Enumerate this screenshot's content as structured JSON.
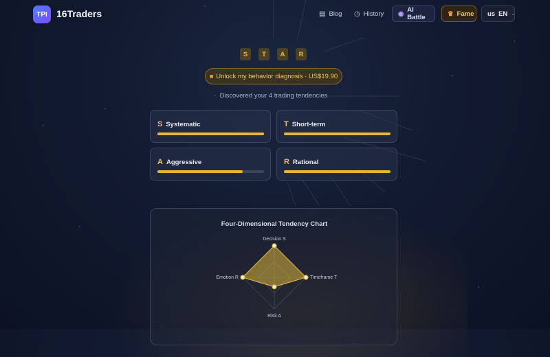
{
  "header": {
    "logo_text": "TPI",
    "brand": "16Traders",
    "nav": [
      {
        "label": "Blog",
        "icon": "blog-icon"
      },
      {
        "label": "History",
        "icon": "clock-icon"
      }
    ],
    "ai_battle": {
      "label": "AI Battle",
      "icon": "robot-icon"
    },
    "fame": {
      "label": "Fame",
      "icon": "crown-icon"
    },
    "language": {
      "prefix": "us",
      "value": "EN",
      "icon": "chevron-down-icon"
    }
  },
  "result": {
    "letters": [
      "S",
      "T",
      "A",
      "R"
    ],
    "unlock_label": "Unlock my behavior diagnosis · US$19.90",
    "unlock_icon": "lock-icon",
    "subtitle": "Discovered your 4 trading tendencies",
    "accent": "#e5b83a"
  },
  "tendencies": [
    {
      "letter": "S",
      "name": "Systematic",
      "level": 1.0
    },
    {
      "letter": "T",
      "name": "Short-term",
      "level": 1.0
    },
    {
      "letter": "A",
      "name": "Aggressive",
      "level": 0.8
    },
    {
      "letter": "R",
      "name": "Rational",
      "level": 1.0
    }
  ],
  "chart_data": {
    "type": "radar",
    "title": "Four-Dimensional Tendency Chart",
    "axes": [
      "Decision S",
      "Timeframe T",
      "Risk A",
      "Emotion R"
    ],
    "values": [
      100,
      100,
      30,
      100
    ],
    "range": [
      0,
      100
    ],
    "color": "#d9b23a"
  }
}
